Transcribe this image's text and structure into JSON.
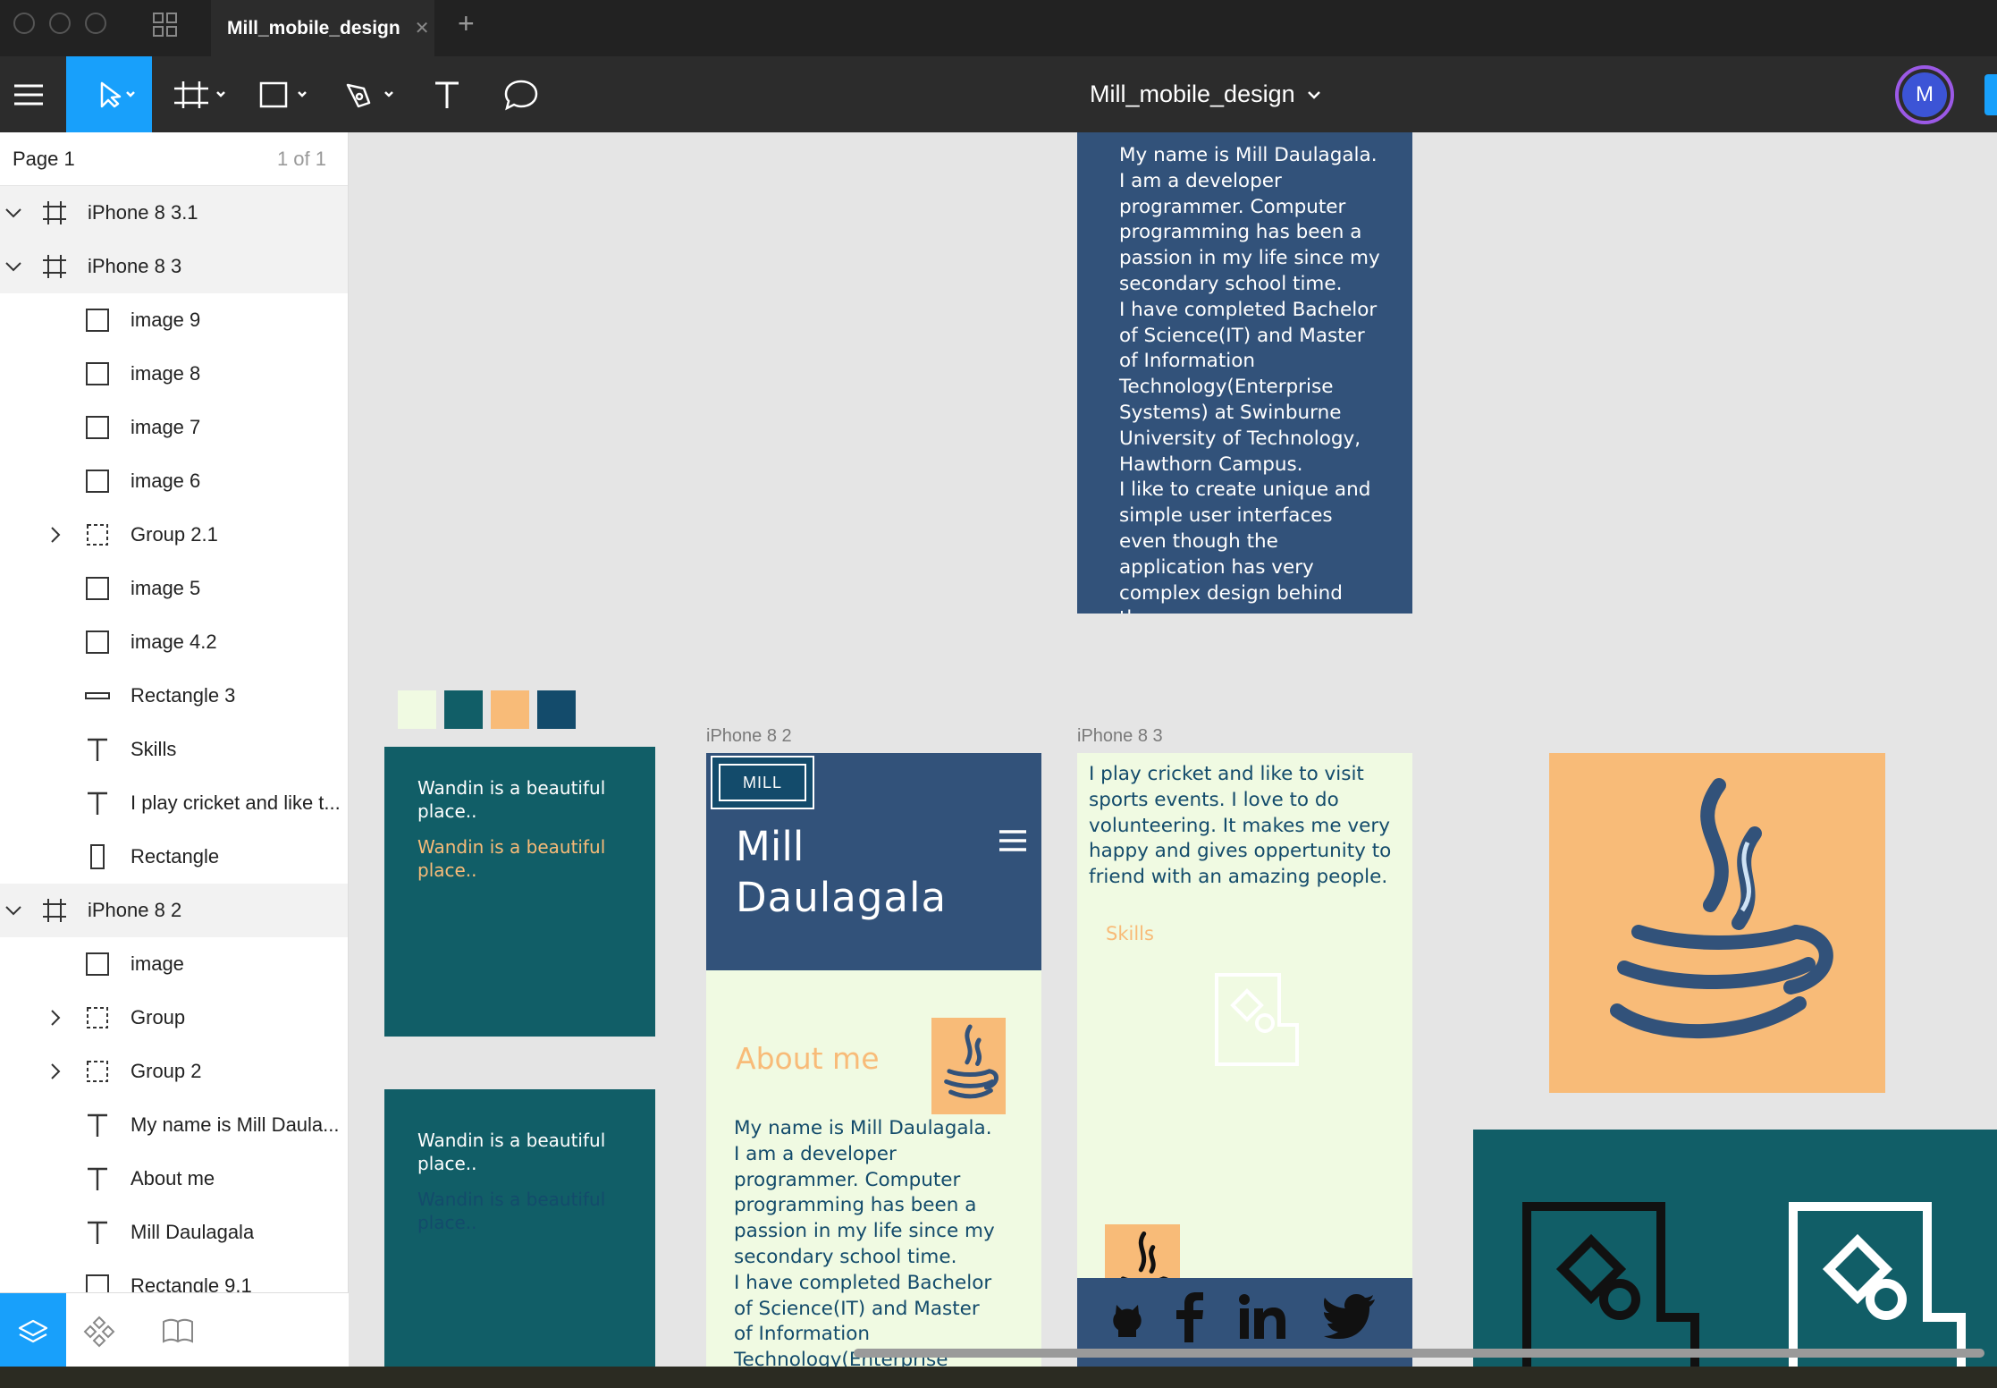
{
  "titlebar": {
    "tab_title": "Mill_mobile_design",
    "close_glyph": "✕",
    "add_glyph": "+"
  },
  "toolbar": {
    "file_name": "Mill_mobile_design",
    "avatar_letter": "M",
    "accent": "#18a0fb"
  },
  "sidebar": {
    "page_name": "Page 1",
    "page_count": "1 of 1",
    "layers": [
      {
        "label": "iPhone 8 3.1",
        "type": "frame",
        "icon": "frame-icon"
      },
      {
        "label": "iPhone 8 3",
        "type": "frame",
        "icon": "frame-icon"
      },
      {
        "label": "image 9",
        "type": "rect",
        "icon": "rectangle-icon"
      },
      {
        "label": "image 8",
        "type": "rect",
        "icon": "rectangle-icon"
      },
      {
        "label": "image 7",
        "type": "rect",
        "icon": "rectangle-icon"
      },
      {
        "label": "image 6",
        "type": "rect",
        "icon": "rectangle-icon"
      },
      {
        "label": "Group 2.1",
        "type": "group",
        "icon": "group-icon"
      },
      {
        "label": "image 5",
        "type": "rect",
        "icon": "rectangle-icon"
      },
      {
        "label": "image 4.2",
        "type": "rect",
        "icon": "rectangle-icon"
      },
      {
        "label": "Rectangle 3",
        "type": "line",
        "icon": "line-rectangle-icon"
      },
      {
        "label": "Skills",
        "type": "text",
        "icon": "text-icon"
      },
      {
        "label": "I play cricket and like t...",
        "type": "text",
        "icon": "text-icon"
      },
      {
        "label": "Rectangle",
        "type": "tall",
        "icon": "tall-rectangle-icon"
      },
      {
        "label": "iPhone 8 2",
        "type": "frame",
        "icon": "frame-icon"
      },
      {
        "label": "image",
        "type": "rect",
        "icon": "rectangle-icon"
      },
      {
        "label": "Group",
        "type": "group",
        "icon": "group-icon"
      },
      {
        "label": "Group 2",
        "type": "group",
        "icon": "group-icon"
      },
      {
        "label": "My name is Mill Daula...",
        "type": "text",
        "icon": "text-icon"
      },
      {
        "label": "About me",
        "type": "text",
        "icon": "text-icon"
      },
      {
        "label": "Mill Daulagala",
        "type": "text",
        "icon": "text-icon"
      },
      {
        "label": "Rectangle 9.1",
        "type": "rect",
        "icon": "rectangle-icon"
      }
    ]
  },
  "canvas": {
    "bio_lines": [
      "My name is Mill Daulagala.",
      "I am a developer",
      "programmer. Computer",
      "programming has been a",
      "passion in my life since my",
      "secondary school time.",
      "I have completed Bachelor",
      "of Science(IT) and Master",
      "of Information",
      "Technology(Enterprise",
      "Systems) at Swinburne",
      "University of Technology,",
      "Hawthorn Campus.",
      "I like to create unique and",
      "simple user interfaces",
      "even though the",
      "application has very",
      "complex design behind",
      "th"
    ],
    "palette": [
      "#f0fae2",
      "#115e67",
      "#f8bb78",
      "#134b6b"
    ],
    "card1_text": "Wandin is a beautiful place..",
    "card1_text2": "Wandin is a beautiful place..",
    "card2_text": "Wandin is a beautiful place..",
    "card2_text2": "Wandin is a beautiful place..",
    "frame2_label": "iPhone 8 2",
    "frame3_label": "iPhone 8 3",
    "mill_badge": "MILL",
    "hero_name_1": "Mill",
    "hero_name_2": "Daulagala",
    "about_title": "About me",
    "about_lines": [
      "My name is Mill Daulagala.",
      "I am a developer",
      "programmer. Computer",
      "programming has been a",
      "passion in my life since my",
      "secondary school time.",
      "I have completed Bachelor",
      "of Science(IT) and Master",
      "of Information",
      "Technology(Enterprise"
    ],
    "hobby_lines": [
      "I play cricket and like to visit",
      "sports events. I love to do",
      "volunteering. It makes me very",
      "happy and gives oppertunity to",
      "friend with an amazing people."
    ],
    "skills_title": "Skills",
    "social_icons": [
      "github-icon",
      "facebook-icon",
      "linkedin-icon",
      "twitter-icon"
    ]
  }
}
